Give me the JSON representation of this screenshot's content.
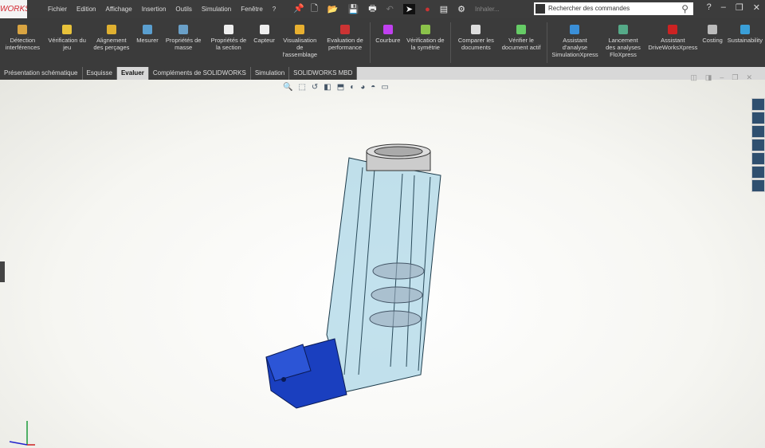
{
  "app": {
    "logo": "WORKS"
  },
  "menu": [
    "Fichier",
    "Edition",
    "Affichage",
    "Insertion",
    "Outils",
    "Simulation",
    "Fenêtre",
    "?"
  ],
  "toolbar": {
    "macro": "Inhaler...",
    "search_placeholder": "Rechercher des commandes"
  },
  "ribbon": [
    {
      "label": "Détection interférences",
      "icon": "interference-icon",
      "color": "#d9a441"
    },
    {
      "label": "Vérification du jeu",
      "icon": "clearance-icon",
      "color": "#e8c23a"
    },
    {
      "label": "Alignement des perçages",
      "icon": "hole-align-icon",
      "color": "#e0b030"
    },
    {
      "label": "Mesurer",
      "icon": "measure-icon",
      "color": "#5a9fd0"
    },
    {
      "label": "Propriétés de masse",
      "icon": "mass-icon",
      "color": "#6aa0c8"
    },
    {
      "label": "Propriétés de la section",
      "icon": "section-icon",
      "color": "#eee"
    },
    {
      "label": "Capteur",
      "icon": "sensor-icon",
      "color": "#eee"
    },
    {
      "label": "Visualisation de l'assemblage",
      "icon": "assembly-vis-icon",
      "color": "#e8b030"
    },
    {
      "label": "Evaluation de performance",
      "icon": "performance-icon",
      "color": "#c33"
    },
    {
      "label": "Courbure",
      "icon": "curvature-icon",
      "color": "#c040f0"
    },
    {
      "label": "Vérification de la symétrie",
      "icon": "symmetry-icon",
      "color": "#8bc34a"
    },
    {
      "label": "Comparer les documents",
      "icon": "compare-icon",
      "color": "#ddd"
    },
    {
      "label": "Vérifier le document actif",
      "icon": "check-doc-icon",
      "color": "#6c6"
    },
    {
      "label": "Assistant d'analyse SimulationXpress",
      "icon": "simxpress-icon",
      "color": "#3a8fd8"
    },
    {
      "label": "Lancement des analyses FloXpress",
      "icon": "floxpress-icon",
      "color": "#5a8"
    },
    {
      "label": "Assistant DriveWorksXpress",
      "icon": "driveworks-icon",
      "color": "#c22"
    },
    {
      "label": "Costing",
      "icon": "costing-icon",
      "color": "#bbb"
    },
    {
      "label": "Sustainability",
      "icon": "sustainability-icon",
      "color": "#3a9fd8"
    }
  ],
  "tabs": [
    "Présentation schématique",
    "Esquisse",
    "Evaluer",
    "Compléments de SOLIDWORKS",
    "Simulation",
    "SOLIDWORKS MBD"
  ],
  "active_tab": "Evaluer",
  "colors": {
    "accent": "#d2262f",
    "cap": "#1a3fbf",
    "body": "#a8d4e6"
  }
}
